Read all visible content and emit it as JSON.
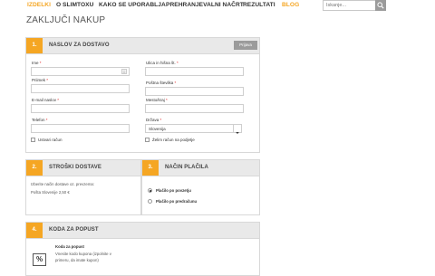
{
  "nav": {
    "items": [
      "IZDELKI",
      "O SLIMTOXU",
      "KAKO SE UPORABLJA",
      "PREHRANJEVALNI NAČRT",
      "REZULTATI",
      "BLOG"
    ],
    "search_placeholder": "Iskanje..."
  },
  "page": {
    "title": "ZAKLJUČI NAKUP"
  },
  "shipping": {
    "number": "1.",
    "title": "NASLOV ZA DOSTAVO",
    "login_button": "Prijava",
    "fields": {
      "ime": "Ime",
      "priimek": "Priimek",
      "email": "E-mail naslov",
      "telefon": "Telefon",
      "ulica": "Ulica in hišna št.",
      "postna": "Poštna številka",
      "mesto": "Mesto/kraj",
      "drzava": "Država",
      "drzava_value": "Slovenija"
    },
    "required_mark": "*",
    "create_account": "Ustvari račun",
    "other_invoice": "Želim račun na podjetje"
  },
  "delivery": {
    "number": "2.",
    "title": "STROŠKI DOSTAVE",
    "hint": "Izberite način dostave oz. prevzema:",
    "option": "Pošta Slovenije 2,50 €"
  },
  "payment": {
    "number": "3.",
    "title": "NAČIN PLAČILA",
    "options": [
      "Plačilo po povzetju",
      "Plačilo po predračunu"
    ]
  },
  "coupon": {
    "number": "4.",
    "title": "KODA ZA POPUST",
    "heading": "Koda za popust",
    "text_line1": "Vnesite kodo kupona (izpolnite v",
    "text_line2": "primeru, da imate kupon)",
    "icon_text": "%"
  },
  "colors": {
    "accent": "#f5a623",
    "header_bg": "#e9e9e9",
    "gray_button": "#9b9b9b"
  }
}
